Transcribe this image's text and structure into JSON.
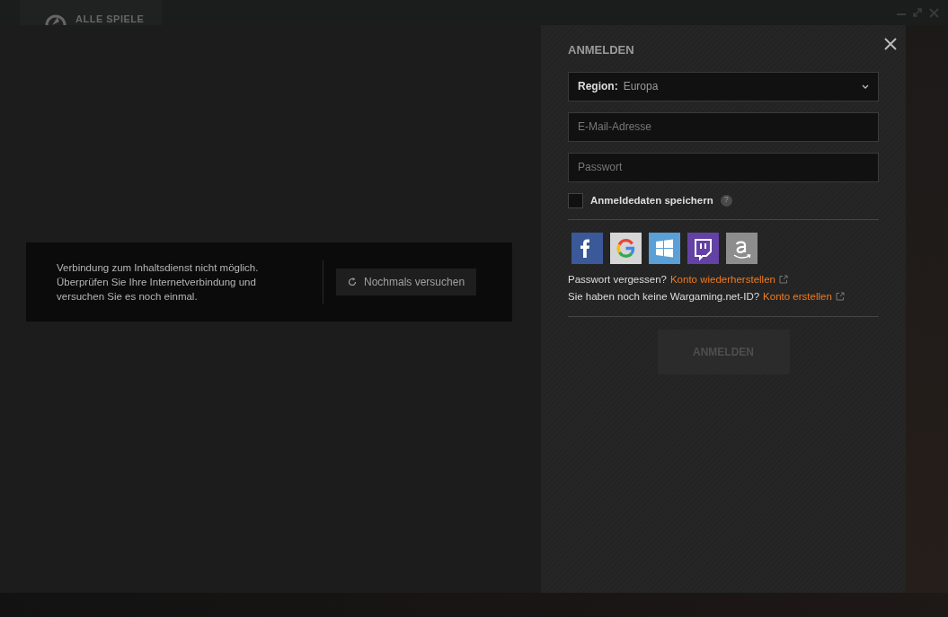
{
  "app": {
    "title": "ALLE SPIELE"
  },
  "error": {
    "message": "Verbindung zum Inhaltsdienst nicht möglich. Überprüfen Sie Ihre Internetverbindung und versuchen Sie es noch einmal.",
    "retry_button": "Nochmals versuchen"
  },
  "login": {
    "title": "ANMELDEN",
    "region": {
      "label": "Region:",
      "value": "Europa"
    },
    "email": {
      "placeholder": "E-Mail-Adresse"
    },
    "password": {
      "placeholder": "Passwort"
    },
    "remember": {
      "label": "Anmeldedaten speichern",
      "checked": false,
      "help": "?"
    },
    "social": [
      {
        "kind": "facebook"
      },
      {
        "kind": "google"
      },
      {
        "kind": "windows"
      },
      {
        "kind": "twitch"
      },
      {
        "kind": "amazon"
      }
    ],
    "links": [
      {
        "text": "Passwort vergessen?",
        "link": "Konto wiederherstellen"
      },
      {
        "text": "Sie haben noch keine Wargaming.net-ID?",
        "link": "Konto erstellen"
      }
    ],
    "submit": {
      "label": "ANMELDEN",
      "disabled": true
    }
  }
}
